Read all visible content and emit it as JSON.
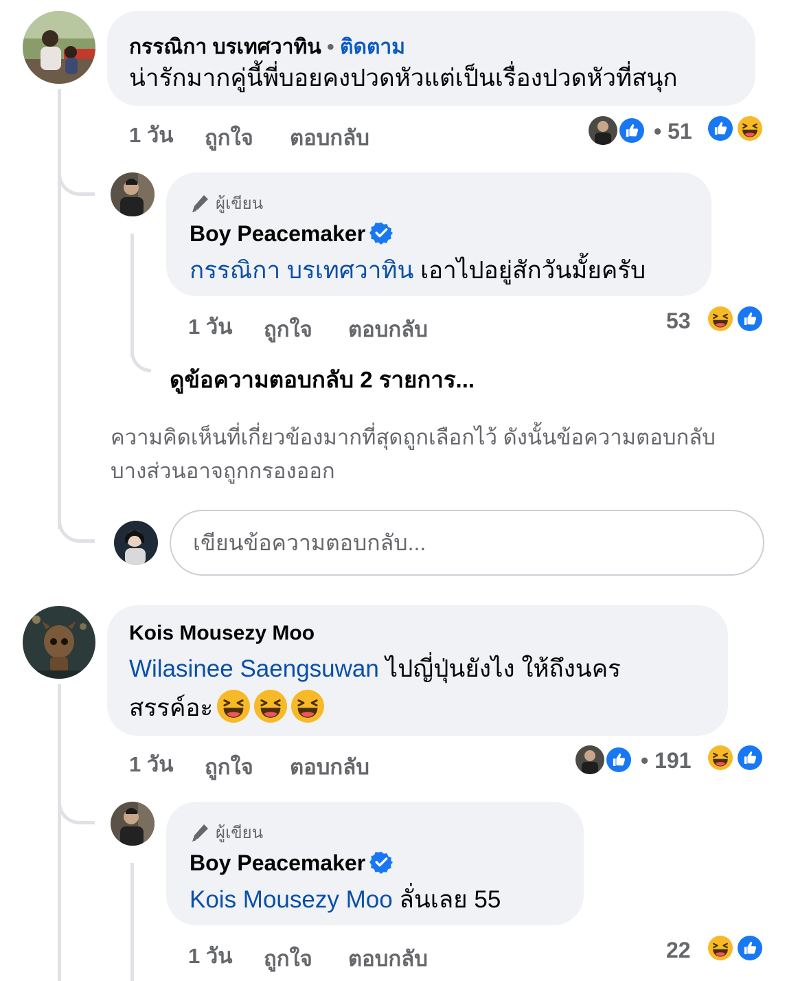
{
  "colors": {
    "bubble": "#f0f2f5",
    "link": "#0a4fa8",
    "meta": "#65676b",
    "like_blue": "#1877f2",
    "haha_yellow": "#f7b928",
    "thread_line": "#dfe1e5"
  },
  "comments": [
    {
      "author": "กรรณิกา บรเทศวาทิน",
      "follow_sep": "•",
      "follow_label": "ติดตาม",
      "text": "น่ารักมากคู่นี้พี่บอยคงปวดหัวแต่เป็นเรื่องปวดหัวที่สนุก",
      "time": "1 วัน",
      "like_label": "ถูกใจ",
      "reply_label": "ตอบกลับ",
      "reaction_count": "• 51",
      "reactions": [
        "like-icon",
        "haha-icon"
      ],
      "reply": {
        "badge_icon": "pencil-icon",
        "badge_label": "ผู้เขียน",
        "author": "Boy Peacemaker",
        "mention": "กรรณิกา บรเทศวาทิน",
        "text": " เอาไปอยู่สักวันมั้ยครับ",
        "time": "1 วัน",
        "like_label": "ถูกใจ",
        "reply_label": "ตอบกลับ",
        "reaction_count": "53",
        "reactions": [
          "haha-icon",
          "like-icon"
        ]
      },
      "view_replies": "ดูข้อความตอบกลับ 2 รายการ...",
      "filter_note": "ความคิดเห็นที่เกี่ยวข้องมากที่สุดถูกเลือกไว้ ดังนั้นข้อความตอบกลับบางส่วนอาจถูกกรองออก",
      "reply_placeholder": "เขียนข้อความตอบกลับ..."
    },
    {
      "author": "Kois Mousezy Moo",
      "mention": "Wilasinee Saengsuwan",
      "text_line1": " ไปญี่ปุ่นยังไง ให้ถึงนคร",
      "text_line2": "สรรค์อะ",
      "emoji_count": 3,
      "time": "1 วัน",
      "like_label": "ถูกใจ",
      "reply_label": "ตอบกลับ",
      "reaction_count": "• 191",
      "reactions": [
        "haha-icon",
        "like-icon"
      ],
      "reply": {
        "badge_icon": "pencil-icon",
        "badge_label": "ผู้เขียน",
        "author": "Boy Peacemaker",
        "mention": "Kois Mousezy Moo",
        "text": " ลั่นเลย 55",
        "time": "1 วัน",
        "like_label": "ถูกใจ",
        "reply_label": "ตอบกลับ",
        "reaction_count": "22",
        "reactions": [
          "haha-icon",
          "like-icon"
        ]
      }
    }
  ]
}
